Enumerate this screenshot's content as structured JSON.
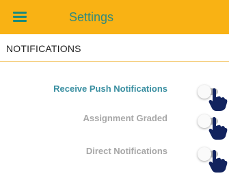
{
  "header": {
    "title": "Settings",
    "menu_icon": "hamburger-menu-icon"
  },
  "section": {
    "title": "NOTIFICATIONS"
  },
  "settings": [
    {
      "label": "Receive Push Notifications",
      "enabled": false,
      "emphasis": "primary"
    },
    {
      "label": "Assignment Graded",
      "enabled": false,
      "emphasis": "secondary"
    },
    {
      "label": "Direct Notifications",
      "enabled": false,
      "emphasis": "secondary"
    }
  ],
  "colors": {
    "header_bg": "#f9b214",
    "header_text": "#2f8a7e",
    "primary_label": "#3a8fa1",
    "secondary_label": "#a7a7a7",
    "pointer_hand": "#12235e"
  },
  "annotation_icon": "pointing-hand-icon"
}
